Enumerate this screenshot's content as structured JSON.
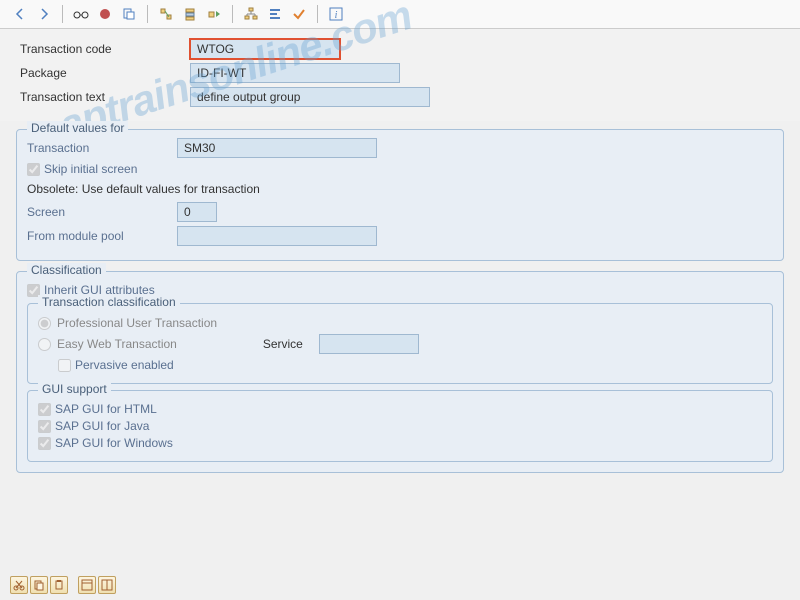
{
  "watermark": "saptrainsonline.com",
  "header": {
    "labels": {
      "tcode": "Transaction code",
      "package": "Package",
      "ttext": "Transaction text"
    },
    "values": {
      "tcode": "WTOG",
      "package": "ID-FI-WT",
      "ttext": "define output group"
    }
  },
  "defaults": {
    "legend": "Default values for",
    "transaction_label": "Transaction",
    "transaction_value": "SM30",
    "skip_initial": "Skip initial screen",
    "obsolete": "Obsolete: Use default values for transaction",
    "screen_label": "Screen",
    "screen_value": "0",
    "module_pool_label": "From module pool",
    "module_pool_value": ""
  },
  "classification": {
    "legend": "Classification",
    "inherit": "Inherit GUI attributes",
    "trans_class_legend": "Transaction classification",
    "professional": "Professional User Transaction",
    "easyweb": "Easy Web Transaction",
    "service_label": "Service",
    "service_value": "",
    "pervasive": "Pervasive enabled",
    "gui_legend": "GUI support",
    "gui_html": "SAP GUI for HTML",
    "gui_java": "SAP GUI for Java",
    "gui_windows": "SAP GUI for Windows"
  }
}
